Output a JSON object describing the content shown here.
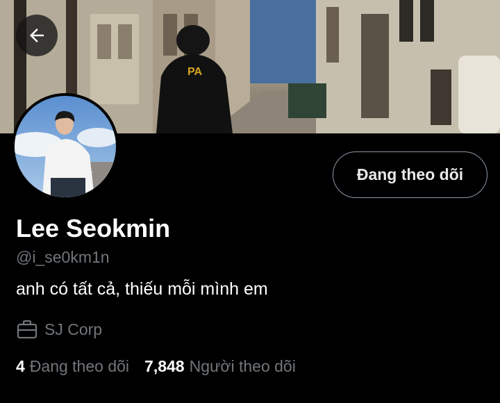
{
  "header": {
    "back_icon": "arrow-left-icon"
  },
  "profile": {
    "display_name": "Lee Seokmin",
    "handle": "@i_se0km1n",
    "bio": "anh có tất cả, thiếu mỗi mình em",
    "work": "SJ Corp",
    "work_icon": "briefcase-icon",
    "follow_button_label": "Đang theo dõi"
  },
  "stats": {
    "following_count": "4",
    "following_label": "Đang theo dõi",
    "followers_count": "7,848",
    "followers_label": "Người theo dõi"
  },
  "colors": {
    "background": "#000000",
    "text_primary": "#e7e9ea",
    "text_secondary": "#71767b",
    "button_border": "#8b98a5"
  }
}
